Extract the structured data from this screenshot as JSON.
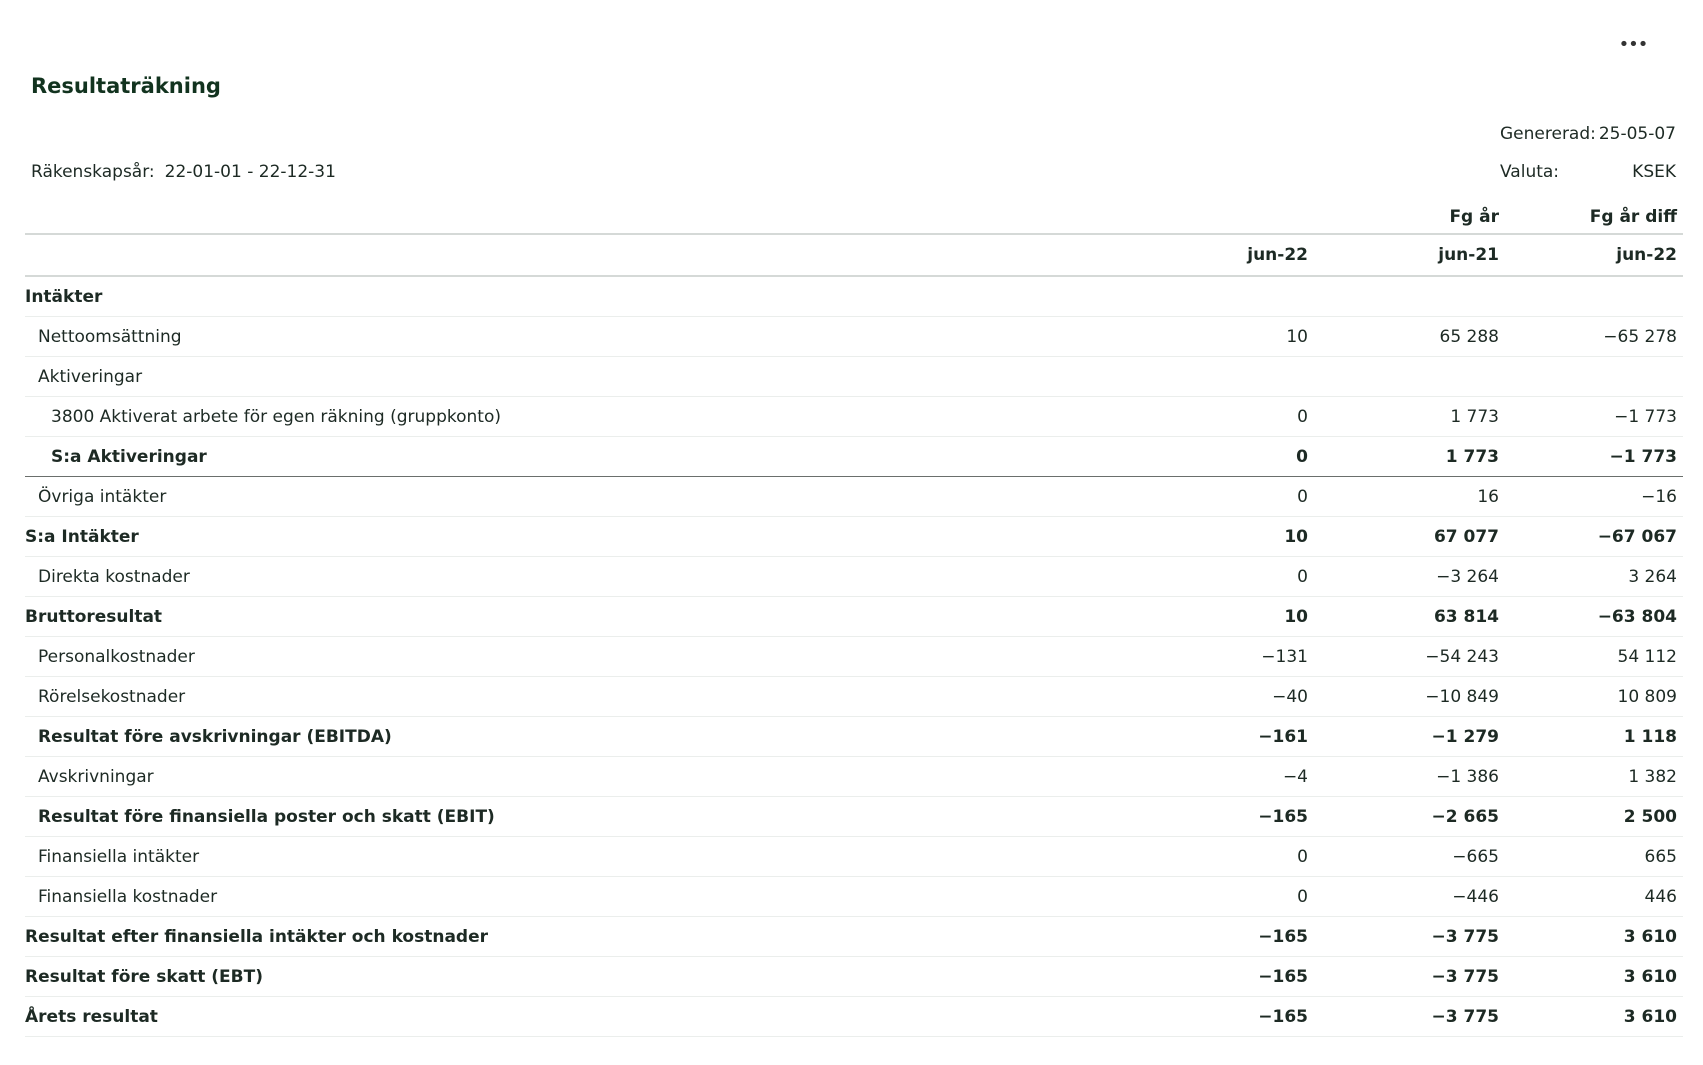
{
  "menu": {
    "label": "•••"
  },
  "report": {
    "title": "Resultaträkning",
    "fiscal_year_label": "Räkenskapsår:",
    "fiscal_year_value": "22-01-01 - 22-12-31",
    "generated_label": "Genererad:",
    "generated_value": "25-05-07",
    "currency_label": "Valuta:",
    "currency_value": "KSEK"
  },
  "columns": {
    "top": [
      "",
      "Fg år",
      "Fg år diff"
    ],
    "bottom": [
      "jun-22",
      "jun-21",
      "jun-22"
    ]
  },
  "rows": [
    {
      "label": "Intäkter",
      "level": 0,
      "bold": true,
      "values": [
        "",
        "",
        ""
      ]
    },
    {
      "label": "Nettoomsättning",
      "level": 1,
      "bold": false,
      "values": [
        "10",
        "65 288",
        "−65 278"
      ]
    },
    {
      "label": "Aktiveringar",
      "level": 1,
      "bold": false,
      "values": [
        "",
        "",
        ""
      ]
    },
    {
      "label": "3800 Aktiverat arbete för egen räkning (gruppkonto)",
      "level": 2,
      "bold": false,
      "values": [
        "0",
        "1 773",
        "−1 773"
      ]
    },
    {
      "label": "S:a Aktiveringar",
      "level": 2,
      "bold": true,
      "underline": true,
      "values": [
        "0",
        "1 773",
        "−1 773"
      ]
    },
    {
      "label": "Övriga intäkter",
      "level": 1,
      "bold": false,
      "values": [
        "0",
        "16",
        "−16"
      ]
    },
    {
      "label": "S:a Intäkter",
      "level": 0,
      "bold": true,
      "values": [
        "10",
        "67 077",
        "−67 067"
      ]
    },
    {
      "label": "Direkta kostnader",
      "level": 1,
      "bold": false,
      "values": [
        "0",
        "−3 264",
        "3 264"
      ]
    },
    {
      "label": "Bruttoresultat",
      "level": 0,
      "bold": true,
      "values": [
        "10",
        "63 814",
        "−63 804"
      ]
    },
    {
      "label": "Personalkostnader",
      "level": 1,
      "bold": false,
      "values": [
        "−131",
        "−54 243",
        "54 112"
      ]
    },
    {
      "label": "Rörelsekostnader",
      "level": 1,
      "bold": false,
      "values": [
        "−40",
        "−10 849",
        "10 809"
      ]
    },
    {
      "label": "Resultat före avskrivningar (EBITDA)",
      "level": 1,
      "bold": true,
      "values": [
        "−161",
        "−1 279",
        "1 118"
      ]
    },
    {
      "label": "Avskrivningar",
      "level": 1,
      "bold": false,
      "values": [
        "−4",
        "−1 386",
        "1 382"
      ]
    },
    {
      "label": "Resultat före finansiella poster och skatt (EBIT)",
      "level": 1,
      "bold": true,
      "values": [
        "−165",
        "−2 665",
        "2 500"
      ]
    },
    {
      "label": "Finansiella intäkter",
      "level": 1,
      "bold": false,
      "values": [
        "0",
        "−665",
        "665"
      ]
    },
    {
      "label": "Finansiella kostnader",
      "level": 1,
      "bold": false,
      "values": [
        "0",
        "−446",
        "446"
      ]
    },
    {
      "label": "Resultat efter finansiella intäkter och kostnader",
      "level": 0,
      "bold": true,
      "values": [
        "−165",
        "−3 775",
        "3 610"
      ]
    },
    {
      "label": "Resultat före skatt (EBT)",
      "level": 0,
      "bold": true,
      "values": [
        "−165",
        "−3 775",
        "3 610"
      ]
    },
    {
      "label": "Årets resultat",
      "level": 0,
      "bold": true,
      "values": [
        "−165",
        "−3 775",
        "3 610"
      ]
    }
  ]
}
